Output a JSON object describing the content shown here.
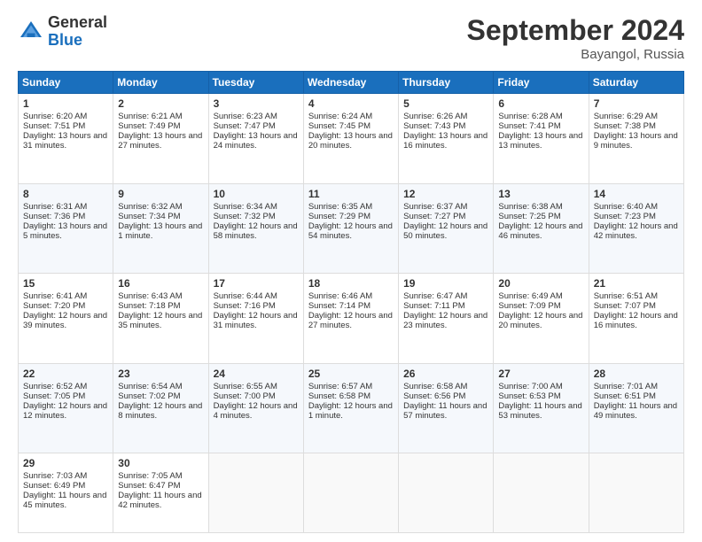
{
  "header": {
    "logo_general": "General",
    "logo_blue": "Blue",
    "month_title": "September 2024",
    "location": "Bayangol, Russia"
  },
  "days_of_week": [
    "Sunday",
    "Monday",
    "Tuesday",
    "Wednesday",
    "Thursday",
    "Friday",
    "Saturday"
  ],
  "weeks": [
    [
      {
        "day": "1",
        "text": "Sunrise: 6:20 AM\nSunset: 7:51 PM\nDaylight: 13 hours and 31 minutes."
      },
      {
        "day": "2",
        "text": "Sunrise: 6:21 AM\nSunset: 7:49 PM\nDaylight: 13 hours and 27 minutes."
      },
      {
        "day": "3",
        "text": "Sunrise: 6:23 AM\nSunset: 7:47 PM\nDaylight: 13 hours and 24 minutes."
      },
      {
        "day": "4",
        "text": "Sunrise: 6:24 AM\nSunset: 7:45 PM\nDaylight: 13 hours and 20 minutes."
      },
      {
        "day": "5",
        "text": "Sunrise: 6:26 AM\nSunset: 7:43 PM\nDaylight: 13 hours and 16 minutes."
      },
      {
        "day": "6",
        "text": "Sunrise: 6:28 AM\nSunset: 7:41 PM\nDaylight: 13 hours and 13 minutes."
      },
      {
        "day": "7",
        "text": "Sunrise: 6:29 AM\nSunset: 7:38 PM\nDaylight: 13 hours and 9 minutes."
      }
    ],
    [
      {
        "day": "8",
        "text": "Sunrise: 6:31 AM\nSunset: 7:36 PM\nDaylight: 13 hours and 5 minutes."
      },
      {
        "day": "9",
        "text": "Sunrise: 6:32 AM\nSunset: 7:34 PM\nDaylight: 13 hours and 1 minute."
      },
      {
        "day": "10",
        "text": "Sunrise: 6:34 AM\nSunset: 7:32 PM\nDaylight: 12 hours and 58 minutes."
      },
      {
        "day": "11",
        "text": "Sunrise: 6:35 AM\nSunset: 7:29 PM\nDaylight: 12 hours and 54 minutes."
      },
      {
        "day": "12",
        "text": "Sunrise: 6:37 AM\nSunset: 7:27 PM\nDaylight: 12 hours and 50 minutes."
      },
      {
        "day": "13",
        "text": "Sunrise: 6:38 AM\nSunset: 7:25 PM\nDaylight: 12 hours and 46 minutes."
      },
      {
        "day": "14",
        "text": "Sunrise: 6:40 AM\nSunset: 7:23 PM\nDaylight: 12 hours and 42 minutes."
      }
    ],
    [
      {
        "day": "15",
        "text": "Sunrise: 6:41 AM\nSunset: 7:20 PM\nDaylight: 12 hours and 39 minutes."
      },
      {
        "day": "16",
        "text": "Sunrise: 6:43 AM\nSunset: 7:18 PM\nDaylight: 12 hours and 35 minutes."
      },
      {
        "day": "17",
        "text": "Sunrise: 6:44 AM\nSunset: 7:16 PM\nDaylight: 12 hours and 31 minutes."
      },
      {
        "day": "18",
        "text": "Sunrise: 6:46 AM\nSunset: 7:14 PM\nDaylight: 12 hours and 27 minutes."
      },
      {
        "day": "19",
        "text": "Sunrise: 6:47 AM\nSunset: 7:11 PM\nDaylight: 12 hours and 23 minutes."
      },
      {
        "day": "20",
        "text": "Sunrise: 6:49 AM\nSunset: 7:09 PM\nDaylight: 12 hours and 20 minutes."
      },
      {
        "day": "21",
        "text": "Sunrise: 6:51 AM\nSunset: 7:07 PM\nDaylight: 12 hours and 16 minutes."
      }
    ],
    [
      {
        "day": "22",
        "text": "Sunrise: 6:52 AM\nSunset: 7:05 PM\nDaylight: 12 hours and 12 minutes."
      },
      {
        "day": "23",
        "text": "Sunrise: 6:54 AM\nSunset: 7:02 PM\nDaylight: 12 hours and 8 minutes."
      },
      {
        "day": "24",
        "text": "Sunrise: 6:55 AM\nSunset: 7:00 PM\nDaylight: 12 hours and 4 minutes."
      },
      {
        "day": "25",
        "text": "Sunrise: 6:57 AM\nSunset: 6:58 PM\nDaylight: 12 hours and 1 minute."
      },
      {
        "day": "26",
        "text": "Sunrise: 6:58 AM\nSunset: 6:56 PM\nDaylight: 11 hours and 57 minutes."
      },
      {
        "day": "27",
        "text": "Sunrise: 7:00 AM\nSunset: 6:53 PM\nDaylight: 11 hours and 53 minutes."
      },
      {
        "day": "28",
        "text": "Sunrise: 7:01 AM\nSunset: 6:51 PM\nDaylight: 11 hours and 49 minutes."
      }
    ],
    [
      {
        "day": "29",
        "text": "Sunrise: 7:03 AM\nSunset: 6:49 PM\nDaylight: 11 hours and 45 minutes."
      },
      {
        "day": "30",
        "text": "Sunrise: 7:05 AM\nSunset: 6:47 PM\nDaylight: 11 hours and 42 minutes."
      },
      {
        "day": "",
        "text": ""
      },
      {
        "day": "",
        "text": ""
      },
      {
        "day": "",
        "text": ""
      },
      {
        "day": "",
        "text": ""
      },
      {
        "day": "",
        "text": ""
      }
    ]
  ]
}
